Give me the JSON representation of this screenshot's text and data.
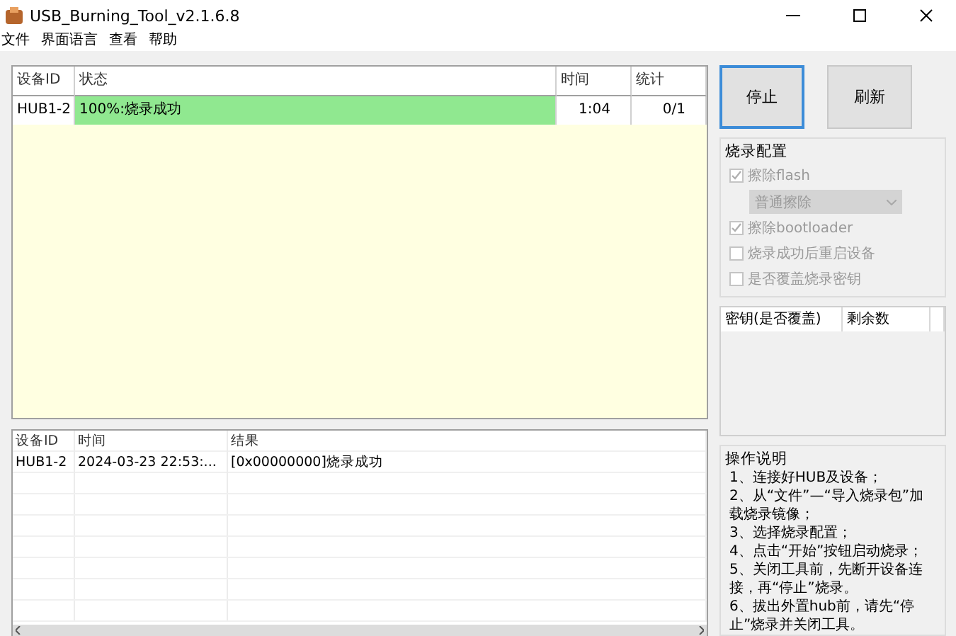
{
  "window": {
    "title": "USB_Burning_Tool_v2.1.6.8"
  },
  "menu": [
    "文件",
    "界面语言",
    "查看",
    "帮助"
  ],
  "device_table": {
    "columns": [
      "设备ID",
      "状态",
      "时间",
      "统计"
    ],
    "rows": [
      {
        "device": "HUB1-2",
        "status": "100%:烧录成功",
        "level": 1,
        "time": "1:04",
        "count": "0/1"
      }
    ]
  },
  "log_table": {
    "columns": [
      "设备ID",
      "时间",
      "结果"
    ],
    "rows": [
      {
        "device": "HUB1-2",
        "time": "2024-03-23 22:53:...",
        "result": "[0x00000000]烧录成功"
      }
    ]
  },
  "buttons": [
    {
      "label": "停止",
      "focused": true
    },
    {
      "label": "刷新",
      "focused": false
    }
  ],
  "config": {
    "title": "烧录配置",
    "options": [
      {
        "kind": "checkbox",
        "label": "擦除flash",
        "checked": true,
        "disabled": true
      },
      {
        "kind": "dropdown",
        "value": "普通擦除",
        "disabled": true
      },
      {
        "kind": "checkbox",
        "label": "擦除bootloader",
        "checked": true,
        "disabled": true
      },
      {
        "kind": "checkbox",
        "label": "烧录成功后重启设备",
        "checked": false,
        "disabled": true
      },
      {
        "kind": "checkbox",
        "label": "是否覆盖烧录密钥",
        "checked": false,
        "disabled": true
      }
    ]
  },
  "key_table": {
    "columns": [
      "密钥(是否覆盖)",
      "剩余数"
    ]
  },
  "instructions": {
    "title": "操作说明",
    "items": [
      "1、连接好HUB及设备；",
      "2、从“文件”—“导入烧录包”加载烧录镜像；",
      "3、选择烧录配置；",
      "4、点击“开始”按钮启动烧录；",
      "5、关闭工具前，先断开设备连接，再“停止”烧录。",
      "6、拔出外置hub前，请先“停止”烧录并关闭工具。"
    ]
  }
}
